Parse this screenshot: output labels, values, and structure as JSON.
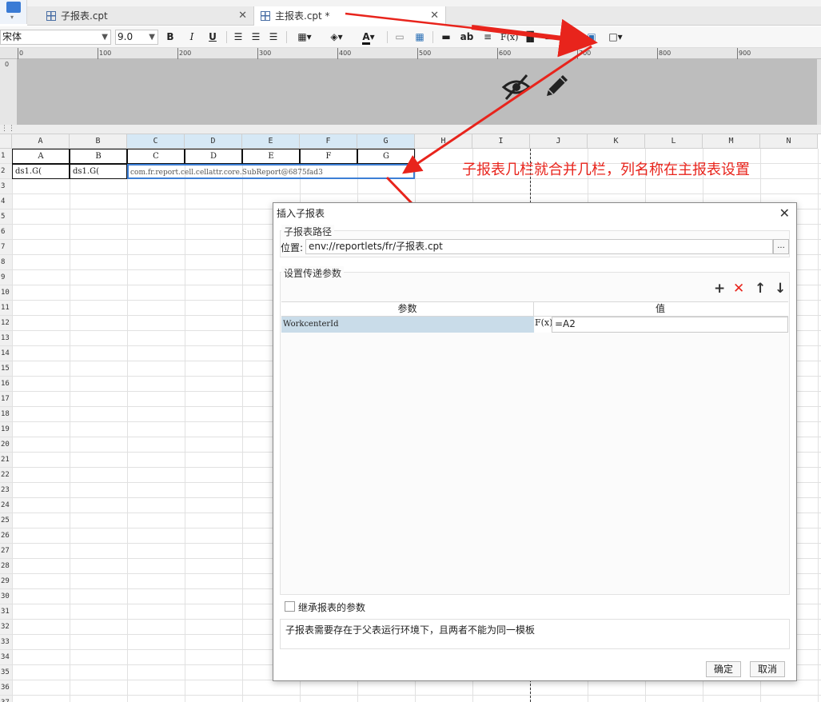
{
  "tabs": [
    {
      "label": "子报表.cpt",
      "active": false
    },
    {
      "label": "主报表.cpt *",
      "active": true
    }
  ],
  "toolbar": {
    "font_family": "宋体",
    "font_size": "9.0",
    "bold": "B",
    "italic": "I",
    "underline": "U",
    "text_color_letter": "A",
    "ab_label": "ab",
    "formula_label": "F(x)"
  },
  "ruler": {
    "ticks": [
      "0",
      "100",
      "200",
      "300",
      "400",
      "500",
      "600",
      "700",
      "800",
      "900"
    ]
  },
  "grid": {
    "columns": [
      "A",
      "B",
      "C",
      "D",
      "E",
      "F",
      "G",
      "H",
      "I",
      "J",
      "K",
      "L",
      "M",
      "N"
    ],
    "selected_columns": [
      "C",
      "D",
      "E",
      "F",
      "G"
    ],
    "rows": [
      "1",
      "2",
      "3",
      "4",
      "5",
      "6",
      "7",
      "8",
      "9",
      "10",
      "11",
      "12",
      "13",
      "14",
      "15",
      "16",
      "17",
      "18",
      "19",
      "20",
      "21",
      "22",
      "23",
      "24",
      "25",
      "26",
      "27",
      "28",
      "29",
      "30",
      "31",
      "32",
      "33",
      "34",
      "35",
      "36",
      "37"
    ],
    "row1": [
      "A",
      "B",
      "C",
      "D",
      "E",
      "F",
      "G"
    ],
    "row2": {
      "a": "ds1.G(",
      "b": "ds1.G(",
      "merged_cde": "com.fr.report.cell.cellattr.core.SubReport@6875fad3"
    }
  },
  "annotation": "子报表几栏就合并几栏，列名称在主报表设置",
  "dialog": {
    "title": "插入子报表",
    "path_group_label": "子报表路径",
    "location_label": "位置:",
    "location_value": "env://reportlets/fr/子报表.cpt",
    "browse_label": "...",
    "params_group_label": "设置传递参数",
    "table_headers": [
      "参数",
      "值"
    ],
    "params": [
      {
        "name": "WorkcenterId",
        "fx": "F(x)",
        "value": "=A2"
      }
    ],
    "inherit_label": "继承报表的参数",
    "inherit_checked": false,
    "note": "子报表需要存在于父表运行环境下，且两者不能为同一模板",
    "ok_label": "确定",
    "cancel_label": "取消"
  },
  "colors": {
    "arrow": "#e8241c",
    "selection": "#3d7fd6"
  }
}
